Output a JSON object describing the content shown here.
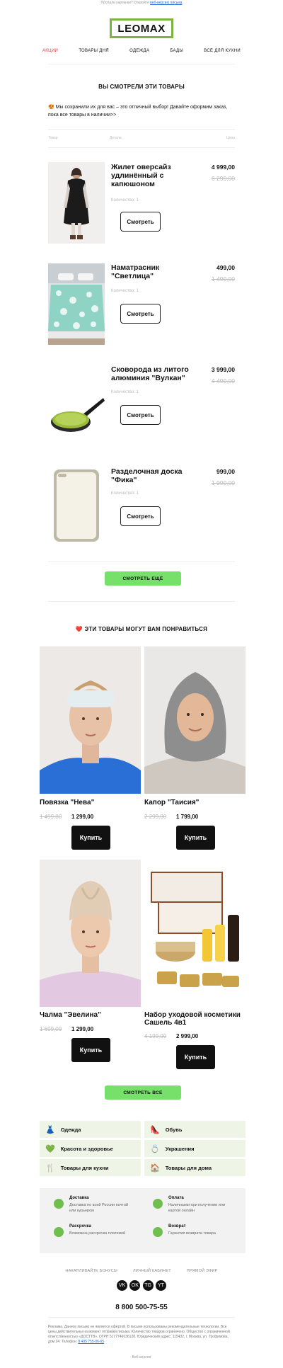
{
  "preheader": {
    "text": "Пропали картинки? Откройте",
    "link": "веб-версию письма"
  },
  "logo": {
    "text": "LEOMAX",
    "color": "#7cb342"
  },
  "nav": [
    "АКЦИИ",
    "ТОВАРЫ ДНЯ",
    "ОДЕЖДА",
    "БАДЫ",
    "ВСЕ ДЛЯ КУХНИ"
  ],
  "viewed": {
    "heading": "ВЫ СМОТРЕЛИ ЭТИ ТОВАРЫ",
    "intro": "😍 Мы сохранили их для вас – это отличный выбор! Давайте оформим заказ, пока все товары в наличии>>",
    "col_product": "Товар",
    "col_details": "Детали",
    "col_price": "Цена",
    "view_label": "Смотреть",
    "items": [
      {
        "title": "Жилет оверсайз удлинённый с капюшоном",
        "qty": "Количество: 1",
        "price": "4 999,00",
        "old": "6 299,00"
      },
      {
        "title": "Наматрасник \"Светлица\"",
        "qty": "Количество: 1",
        "price": "499,00",
        "old": "1 499,00"
      },
      {
        "title": "Сковорода из литого алюминия \"Вулкан\"",
        "qty": "Количество: 1",
        "price": "3 999,00",
        "old": "4 499,00"
      },
      {
        "title": "Разделочная доска \"Фика\"",
        "qty": "Количество: 1",
        "price": "999,00",
        "old": "1 999,00"
      }
    ],
    "more_label": "СМОТРЕТЬ ЕЩЁ"
  },
  "recommend": {
    "heading": "❤️ ЭТИ ТОВАРЫ МОГУТ ВАМ ПОНРАВИТЬСЯ",
    "buy_label": "Купить",
    "cards": [
      {
        "title": "Повязка \"Нева\"",
        "old": "1 499,00",
        "price": "1 299,00"
      },
      {
        "title": "Капор \"Таисия\"",
        "old": "2 299,00",
        "price": "1 799,00"
      },
      {
        "title": "Чалма \"Эвелина\"",
        "old": "1 699,00",
        "price": "1 299,00"
      },
      {
        "title": "Набор уходовой косметики Сашель 4в1",
        "old": "4 199,00",
        "price": "2 999,00"
      }
    ],
    "all_label": "СМОТРЕТЬ ВСЕ"
  },
  "categories": [
    "Одежда",
    "Обувь",
    "Красота и здоровье",
    "Украшения",
    "Товары для кухни",
    "Товары для дома"
  ],
  "info": [
    {
      "title": "Доставка",
      "text": "Доставка по всей России почтой или курьером"
    },
    {
      "title": "Оплата",
      "text": "Наличными при получении или картой онлайн"
    },
    {
      "title": "Рассрочка",
      "text": "Возможна рассрочка платежей"
    },
    {
      "title": "Возврат",
      "text": "Гарантия возврата товара"
    }
  ],
  "footer": {
    "links": [
      "НАКАПЛИВАЙТЕ БОНУСЫ",
      "ЛИЧНЫЙ КАБИНЕТ",
      "ПРЯМОЙ ЭФИР"
    ],
    "social": [
      "VK",
      "OK",
      "TG",
      "YT"
    ],
    "phone": "8 800 500-75-55",
    "legal": "Реклама. Данное письмо не является офертой. В письме использованы рекомендательные технологии. Все цены действительны на момент отправки письма. Количество товаров ограничено. Общество с ограниченной ответственностью «ДОСТТВ». ОГРН 5177746036128. Юридический адрес: 115432, г. Москва, ул. Трофимова, дом 24. Телефон:",
    "legal_phone": "8 495 755-96-65",
    "web": "Веб-версия"
  }
}
